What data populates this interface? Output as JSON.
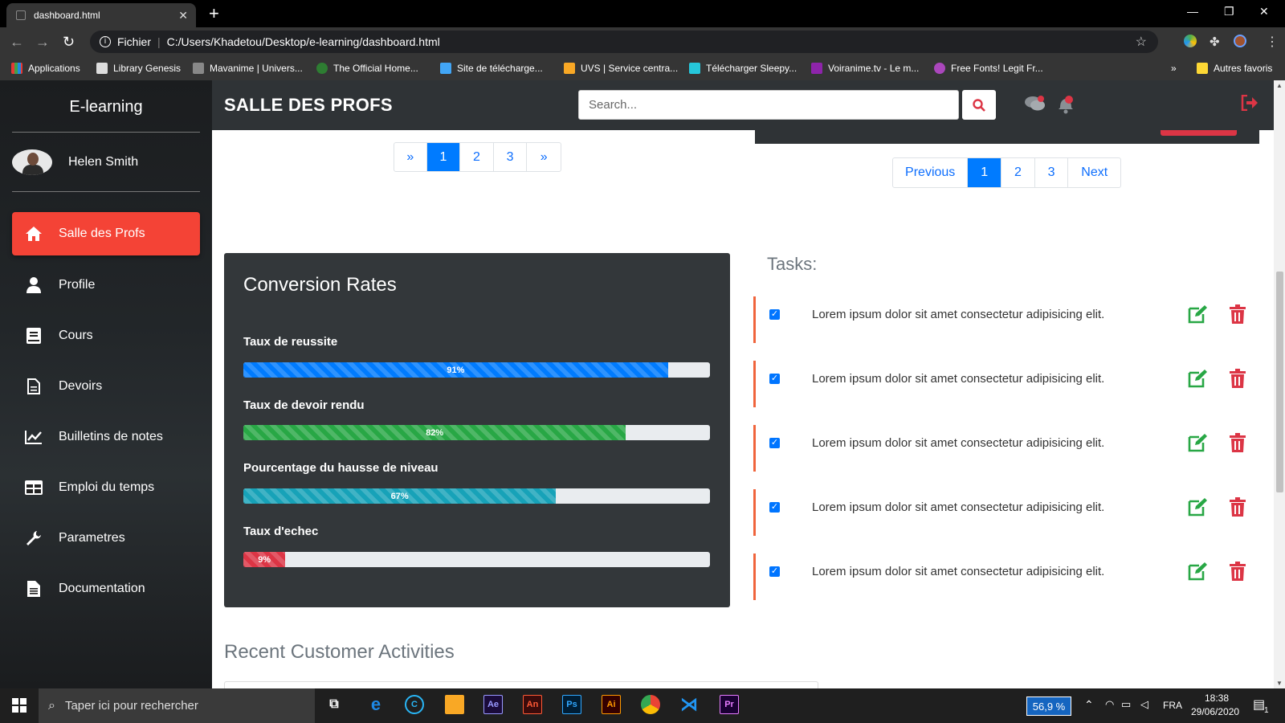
{
  "browser": {
    "tab_title": "dashboard.html",
    "url_scheme": "Fichier",
    "url": "C:/Users/Khadetou/Desktop/e-learning/dashboard.html",
    "bookmarks": [
      "Applications",
      "Library Genesis",
      "Mavanime | Univers...",
      "The Official Home...",
      "Site de télécharge...",
      "UVS | Service centra...",
      "Télécharger Sleepy...",
      "Voiranime.tv - Le m...",
      "Free Fonts! Legit Fr..."
    ],
    "more": "»",
    "other_bookmarks": "Autres favoris"
  },
  "sidebar": {
    "brand": "E-learning",
    "user_name": "Helen Smith",
    "items": [
      {
        "label": "Salle des Profs",
        "icon": "home-icon"
      },
      {
        "label": "Profile",
        "icon": "user-icon"
      },
      {
        "label": "Cours",
        "icon": "book-icon"
      },
      {
        "label": "Devoirs",
        "icon": "file-icon"
      },
      {
        "label": "Builletins de notes",
        "icon": "chart-line-icon"
      },
      {
        "label": "Emploi du temps",
        "icon": "table-icon"
      },
      {
        "label": "Parametres",
        "icon": "wrench-icon"
      },
      {
        "label": "Documentation",
        "icon": "document-icon"
      }
    ],
    "active_color": "#f44336"
  },
  "header": {
    "title": "SALLE DES PROFS",
    "search_placeholder": "Search..."
  },
  "pagination_left": {
    "prev": "»",
    "pages": [
      "1",
      "2",
      "3"
    ],
    "next": "»",
    "active": "1"
  },
  "pagination_right": {
    "prev": "Previous",
    "pages": [
      "1",
      "2",
      "3"
    ],
    "next": "Next",
    "active": "1"
  },
  "conversion": {
    "title": "Conversion Rates",
    "bars": [
      {
        "label": "Taux de reussite",
        "value": 91,
        "text": "91%",
        "color": "#007bff"
      },
      {
        "label": "Taux de devoir rendu",
        "value": 82,
        "text": "82%",
        "color": "#28a745"
      },
      {
        "label": "Pourcentage du hausse de niveau",
        "value": 67,
        "text": "67%",
        "color": "#17a2b8"
      },
      {
        "label": "Taux d'echec",
        "value": 9,
        "text": "9%",
        "color": "#dc3545"
      }
    ]
  },
  "tasks": {
    "title": "Tasks:",
    "items": [
      "Lorem ipsum dolor sit amet consectetur adipisicing elit.",
      "Lorem ipsum dolor sit amet consectetur adipisicing elit.",
      "Lorem ipsum dolor sit amet consectetur adipisicing elit.",
      "Lorem ipsum dolor sit amet consectetur adipisicing elit.",
      "Lorem ipsum dolor sit amet consectetur adipisicing elit."
    ]
  },
  "recent": {
    "title": "Recent Customer Activities"
  },
  "taskbar": {
    "search_placeholder": "Taper ici pour rechercher",
    "apps": [
      "Ae",
      "An",
      "Ps",
      "Ai",
      "Pr"
    ],
    "zoom": "56,9 %",
    "lang": "FRA",
    "time": "18:38",
    "date": "29/06/2020",
    "notif_count": "1"
  }
}
